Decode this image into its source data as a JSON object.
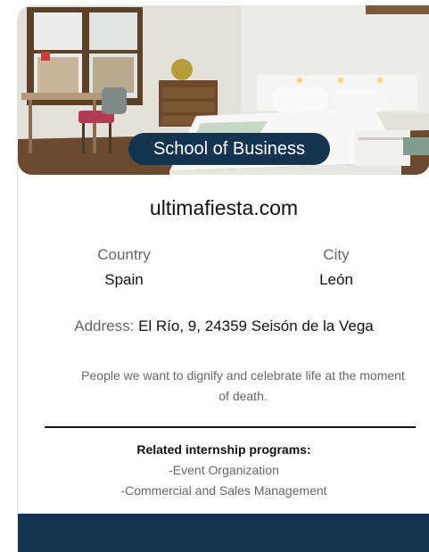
{
  "card": {
    "badge": "School of Business",
    "title": "ultimafiesta.com",
    "country_label": "Country",
    "country_value": "Spain",
    "city_label": "City",
    "city_value": "León",
    "address_label": "Address:",
    "address_value": "El Río, 9, 24359 Seisón de la Vega",
    "description": "People we want to dignify and celebrate life at the moment of death.",
    "related_heading": "Related internship programs:",
    "related_items": [
      "-Event Organization",
      "-Commercial and Sales Management"
    ]
  },
  "colors": {
    "accent": "#153452",
    "muted_text": "#666666",
    "text": "#111111"
  }
}
